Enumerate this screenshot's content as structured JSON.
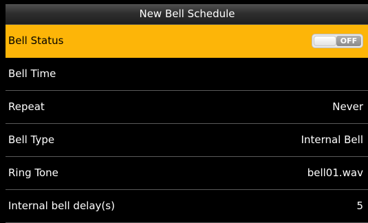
{
  "title": "New Bell Schedule",
  "menu": {
    "items": [
      {
        "label": "Bell Status",
        "toggle": "OFF",
        "selected": true
      },
      {
        "label": "Bell Time",
        "value": ""
      },
      {
        "label": "Repeat",
        "value": "Never"
      },
      {
        "label": "Bell Type",
        "value": "Internal Bell"
      },
      {
        "label": "Ring Tone",
        "value": "bell01.wav"
      },
      {
        "label": "Internal bell delay(s)",
        "value": "5"
      }
    ]
  },
  "colors": {
    "selected_row": "#fdb508",
    "background": "#000000",
    "text": "#ffffff"
  }
}
